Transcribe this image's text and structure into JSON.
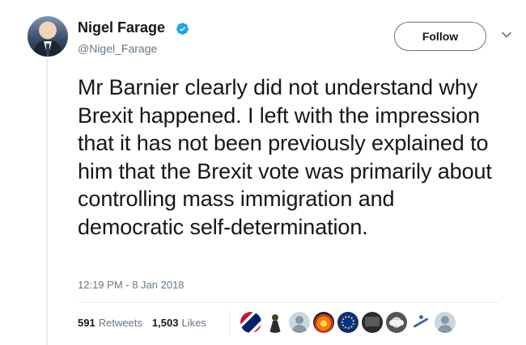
{
  "author": {
    "name": "Nigel Farage",
    "handle": "@Nigel_Farage",
    "verified": true
  },
  "follow_button": {
    "label": "Follow"
  },
  "tweet": {
    "text": "Mr Barnier clearly did not understand why Brexit happened. I left with the impression that it has not been previously explained to him that the Brexit vote was primarily about controlling mass immigration and democratic self-determination.",
    "timestamp": "12:19 PM - 8 Jan 2018"
  },
  "stats": {
    "retweets_count": "591",
    "retweets_label": "Retweets",
    "likes_count": "1,503",
    "likes_label": "Likes"
  },
  "liker_avatars": [
    "flag-avatar",
    "figure-avatar",
    "default-avatar",
    "fire-avatar",
    "eu-avatar",
    "tv-avatar",
    "car-avatar",
    "dancer-avatar",
    "default-avatar"
  ],
  "colors": {
    "text": "#14171a",
    "secondary": "#657786",
    "verified_blue": "#1da1f2",
    "divider": "#e6ecf0"
  }
}
